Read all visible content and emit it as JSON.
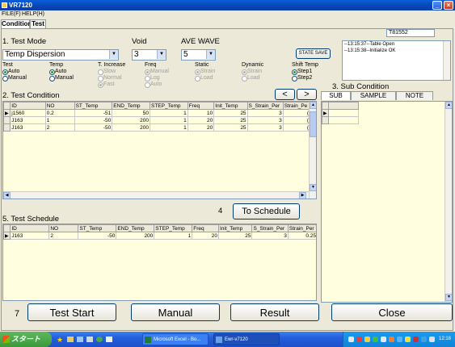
{
  "window": {
    "title": "VR7120"
  },
  "menubar": {
    "file": "FILE(F)",
    "help": "HELP(H)"
  },
  "tabs": [
    "Condition",
    "Test"
  ],
  "serial_number": "T81552",
  "test_mode": {
    "heading": "1. Test Mode",
    "value": "Temp Dispersion"
  },
  "void": {
    "heading": "Void",
    "value": "3"
  },
  "ave_wave": {
    "heading": "AVE WAVE",
    "value": "5"
  },
  "state_save_label": "STATE SAVE",
  "log": [
    "--13:15:37--Table Open",
    "--13:15:38--Initialize OK"
  ],
  "options": [
    {
      "title": "Test",
      "items": [
        {
          "label": "Auto",
          "on": true,
          "dis": false
        },
        {
          "label": "Manual",
          "on": false,
          "dis": false
        }
      ]
    },
    {
      "title": "Temp",
      "items": [
        {
          "label": "Auto",
          "on": true,
          "dis": false
        },
        {
          "label": "Manual",
          "on": false,
          "dis": false
        }
      ]
    },
    {
      "title": "T. Increase",
      "items": [
        {
          "label": "Slow",
          "on": false,
          "dis": true
        },
        {
          "label": "Normal",
          "on": false,
          "dis": true
        },
        {
          "label": "Fast",
          "on": true,
          "dis": true
        }
      ]
    },
    {
      "title": "Freq",
      "items": [
        {
          "label": "Manual",
          "on": true,
          "dis": true
        },
        {
          "label": "Log",
          "on": false,
          "dis": true
        },
        {
          "label": "Auto",
          "on": false,
          "dis": true
        }
      ]
    },
    {
      "title": "Static",
      "items": [
        {
          "label": "Strain",
          "on": true,
          "dis": true
        },
        {
          "label": "Load",
          "on": false,
          "dis": true
        }
      ]
    },
    {
      "title": "Dynamic",
      "items": [
        {
          "label": "Strain",
          "on": true,
          "dis": true
        },
        {
          "label": "Load",
          "on": false,
          "dis": true
        }
      ]
    },
    {
      "title": "Shift Temp",
      "items": [
        {
          "label": "Step1",
          "on": true,
          "dis": false
        },
        {
          "label": "Step2",
          "on": false,
          "dis": false
        }
      ]
    }
  ],
  "test_condition": {
    "heading": "2. Test Condition",
    "prev_label": "<",
    "next_label": ">",
    "columns": [
      "ID",
      "NO",
      "ST_Temp",
      "END_Temp",
      "STEP_Temp",
      "Freq",
      "Init_Temp",
      "S_Strain_Per",
      "Strain_Pe"
    ],
    "rows": [
      [
        "j1560",
        "0.2",
        "-51",
        "50",
        "1",
        "10",
        "25",
        "3",
        "("
      ],
      [
        "J163",
        "1",
        "-50",
        "200",
        "1",
        "20",
        "25",
        "3",
        "("
      ],
      [
        "J163",
        "2",
        "-50",
        "200",
        "1",
        "20",
        "25",
        "3",
        "("
      ]
    ]
  },
  "sub_condition": {
    "heading": "3. Sub Condition",
    "tabs": [
      "SUB",
      "SAMPLE",
      "NOTE"
    ]
  },
  "step4": "4",
  "to_schedule_label": "To Schedule",
  "test_schedule": {
    "heading": "5. Test Schedule",
    "columns": [
      "ID",
      "NO",
      "ST_Temp",
      "END_Temp",
      "STEP_Temp",
      "Freq",
      "Init_Temp",
      "S_Strain_Per",
      "Strain_Per"
    ],
    "rows": [
      [
        "J163",
        "2",
        "-50",
        "200",
        "1",
        "20",
        "25",
        "3",
        "0.25"
      ]
    ]
  },
  "step7": "7",
  "buttons": {
    "test_start": "Test Start",
    "manual": "Manual",
    "result": "Result",
    "close": "Close"
  },
  "taskbar": {
    "start": "スタート",
    "tasks": [
      "Microsoft Excel - Bo...",
      "Ewr-v7120"
    ],
    "clock": "12:18"
  }
}
